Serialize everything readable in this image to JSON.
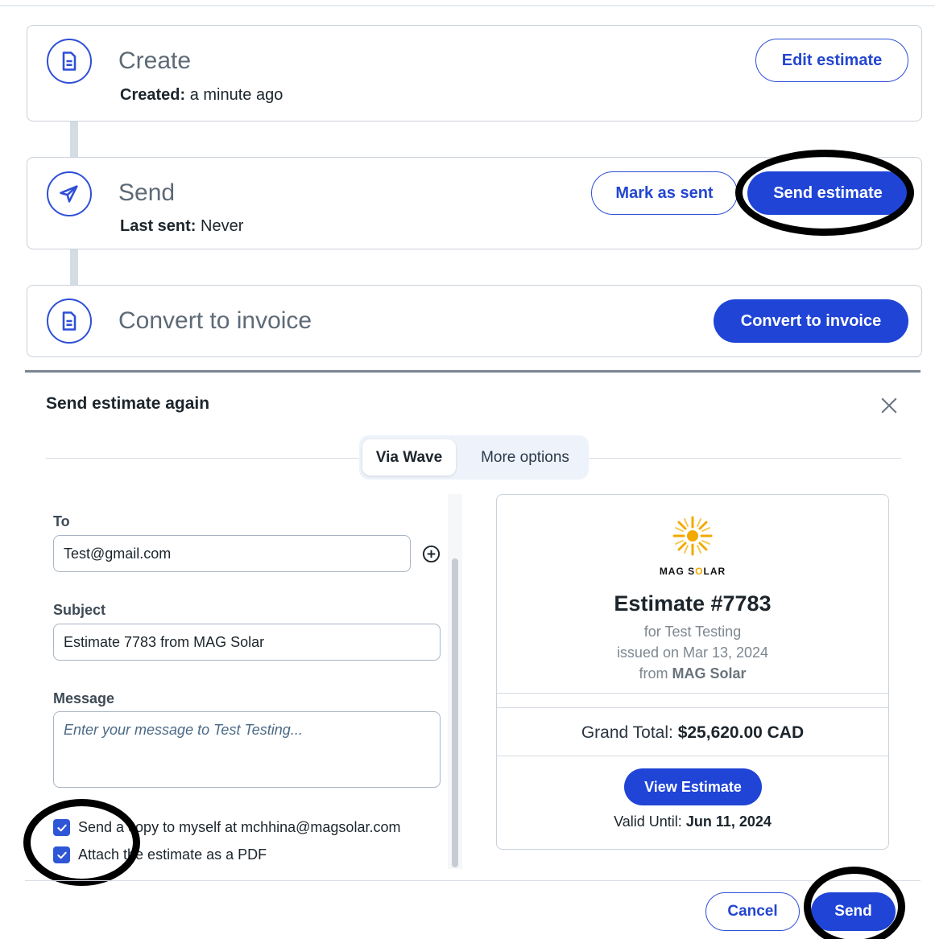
{
  "steps": {
    "create": {
      "title": "Create",
      "status_label": "Created:",
      "status_value": " a minute ago",
      "edit_label": "Edit estimate"
    },
    "send": {
      "title": "Send",
      "status_label": "Last sent:",
      "status_value": " Never",
      "mark_sent_label": "Mark as sent",
      "send_estimate_label": "Send estimate"
    },
    "convert": {
      "title": "Convert to invoice",
      "button_label": "Convert to invoice"
    }
  },
  "modal": {
    "title": "Send estimate again",
    "tabs": [
      {
        "label": "Via Wave",
        "active": true
      },
      {
        "label": "More options",
        "active": false
      }
    ],
    "to_label": "To",
    "to_value": "Test@gmail.com",
    "subject_label": "Subject",
    "subject_value": "Estimate 7783 from MAG Solar",
    "message_label": "Message",
    "message_placeholder": "Enter your message to Test Testing...",
    "checkboxes": [
      {
        "label": "Send a copy to myself at mchhina@magsolar.com",
        "checked": true
      },
      {
        "label": "Attach the estimate as a PDF",
        "checked": true
      }
    ],
    "cancel_label": "Cancel",
    "send_label": "Send"
  },
  "preview": {
    "logo_text_pre": "MAG S",
    "logo_text_o": "O",
    "logo_text_post": "LAR",
    "title": "Estimate #7783",
    "for_line": "for Test Testing",
    "issued_line": "issued on Mar 13, 2024",
    "from_prefix": "from ",
    "from_company": "MAG Solar",
    "grand_label": "Grand Total: ",
    "grand_value": "$25,620.00 CAD",
    "view_label": "View Estimate",
    "valid_label": "Valid Until: ",
    "valid_value": "Jun 11, 2024"
  },
  "colors": {
    "primary": "#1f44d6",
    "border": "#c9d1dc",
    "highlight_ring": "#000000"
  }
}
